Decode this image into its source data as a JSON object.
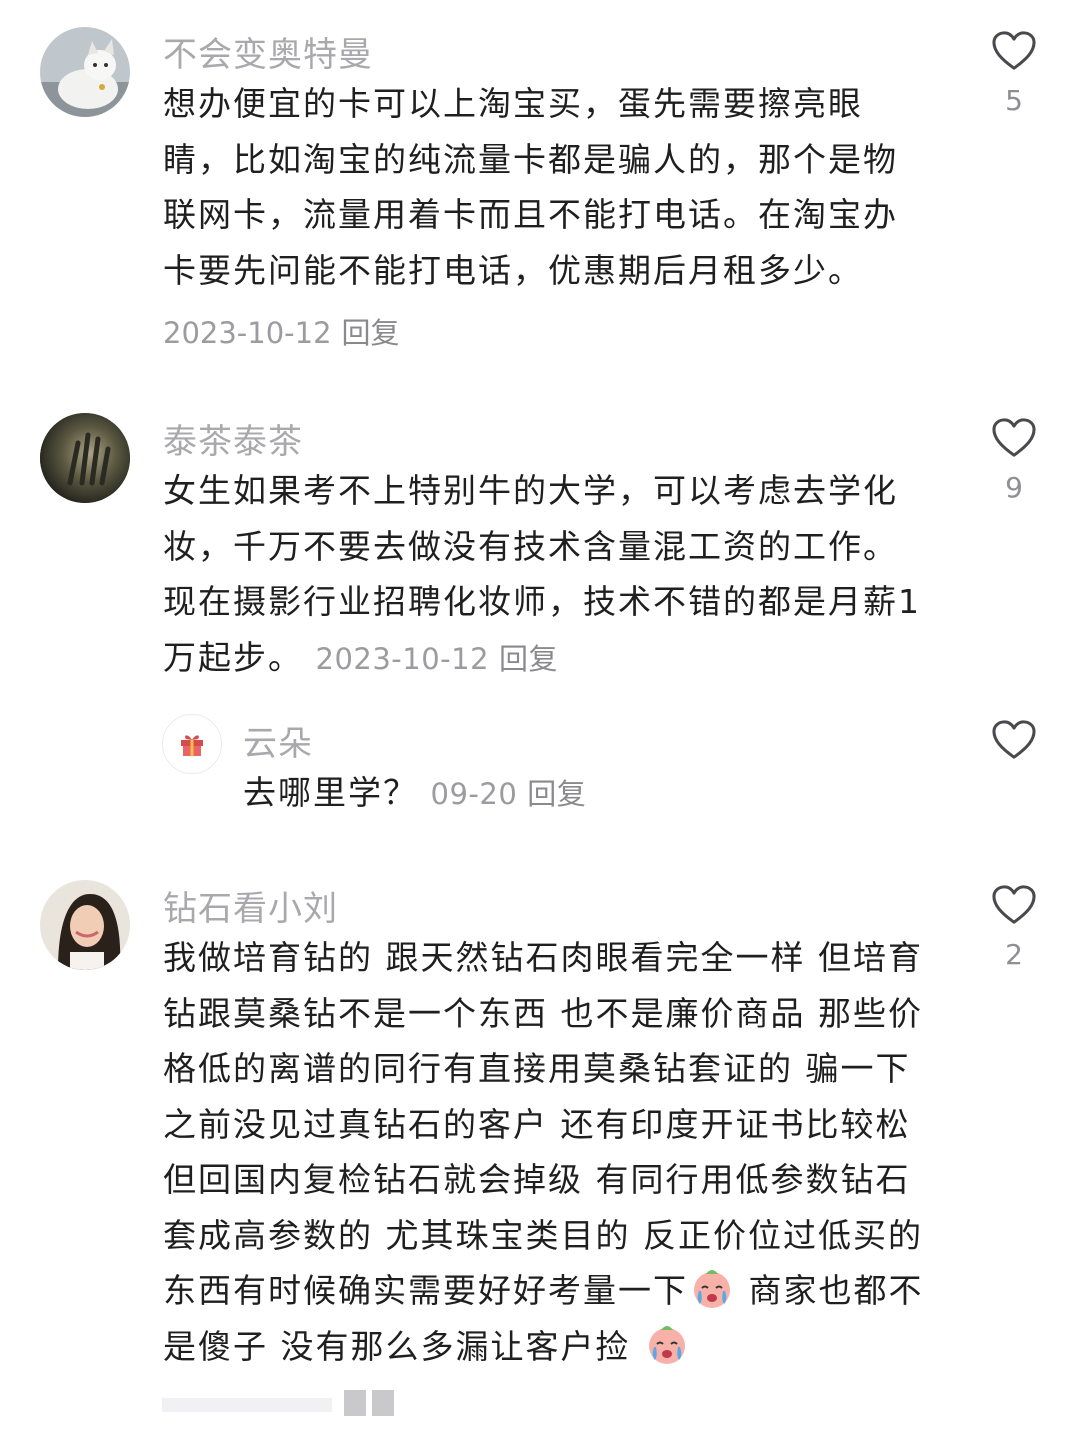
{
  "comments": [
    {
      "username": "不会变奥特曼",
      "lines": [
        "想办便宜的卡可以上淘宝买，蛋先需要擦亮眼",
        "睛，比如淘宝的纯流量卡都是骗人的，那个是物",
        "联网卡，流量用着卡而且不能打电话。在淘宝办",
        "卡要先问能不能打电话，优惠期后月租多少。"
      ],
      "date": "2023-10-12",
      "reply_label": "回复",
      "like_count": "5"
    },
    {
      "username": "泰茶泰茶",
      "lines": [
        "女生如果考不上特别牛的大学，可以考虑去学化",
        "妆，千万不要去做没有技术含量混工资的工作。",
        "现在摄影行业招聘化妆师，技术不错的都是月薪1",
        "万起步。"
      ],
      "date": "2023-10-12",
      "reply_label": "回复",
      "like_count": "9",
      "replies": [
        {
          "username": "云朵",
          "text": "去哪里学？",
          "date": "09-20",
          "reply_label": "回复",
          "avatar_icon": "gift-icon"
        }
      ]
    },
    {
      "username": "钻石看小刘",
      "lines": [
        "我做培育钻的 跟天然钻石肉眼看完全一样 但培育",
        "钻跟莫桑钻不是一个东西 也不是廉价商品 那些价",
        "格低的离谱的同行有直接用莫桑钻套证的 骗一下",
        "之前没见过真钻石的客户 还有印度开证书比较松",
        "但回国内复检钻石就会掉级 有同行用低参数钻石",
        "套成高参数的 尤其珠宝类目的 反正价位过低买的"
      ],
      "line7_before": "东西有时候确实需要好好考量一下",
      "line7_after": " 商家也都不",
      "line8_before": "是傻子 没有那么多漏让客户捡 ",
      "emoji_icon": "crying-face-icon",
      "like_count": "2"
    }
  ],
  "colors": {
    "username": "#a9a9ad",
    "body": "#1f1f1f",
    "meta": "#9c9ca0",
    "heart_outline": "#4a4a4e"
  }
}
